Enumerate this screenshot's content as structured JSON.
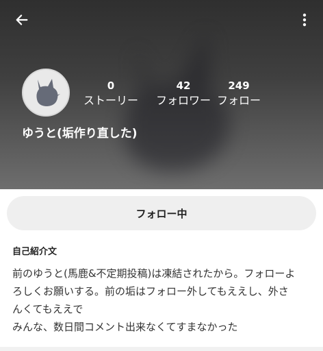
{
  "profile": {
    "display_name": "ゆうと(垢作り直した)",
    "stats": [
      {
        "count": "0",
        "label": "ストーリー"
      },
      {
        "count": "42",
        "label": "フォロワー"
      },
      {
        "count": "249",
        "label": "フォロー"
      }
    ]
  },
  "actions": {
    "follow_button_label": "フォロー中"
  },
  "bio": {
    "title": "自己紹介文",
    "lines": [
      "前のゆうと(馬鹿&不定期投稿)は凍結されたから。フォローよ",
      "ろしくお願いする。前の垢はフォロー外してもええし、外さ",
      "んくてもええで",
      "みんな、数日間コメント出来なくてすまなかった"
    ]
  },
  "icons": {
    "back": "arrow-left-icon",
    "more": "more-vertical-icon",
    "avatar": "cat-silhouette-avatar"
  },
  "colors": {
    "header_dark": "#2f2f2f",
    "header_light": "#6e6e6e",
    "button_bg": "#efefef",
    "avatar_bg": "#e9e9e9",
    "cat_silhouette": "#666b78"
  }
}
